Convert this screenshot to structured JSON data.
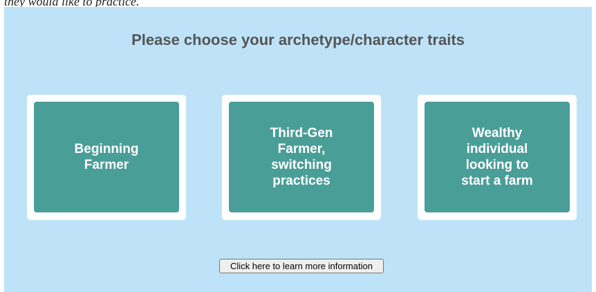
{
  "caption": {
    "text": "they would like to practice."
  },
  "heading": "Please choose your archetype/character traits",
  "archetypes": [
    {
      "label": "Beginning Farmer"
    },
    {
      "label": "Third-Gen Farmer, switching practices"
    },
    {
      "label": "Wealthy individual looking to start a farm"
    }
  ],
  "info_button": {
    "label": "Click here to learn more information"
  },
  "colors": {
    "panel_background": "#bee3f8",
    "card_border": "#ffffff",
    "card_fill": "#4a9e98",
    "heading_text": "#555555"
  }
}
